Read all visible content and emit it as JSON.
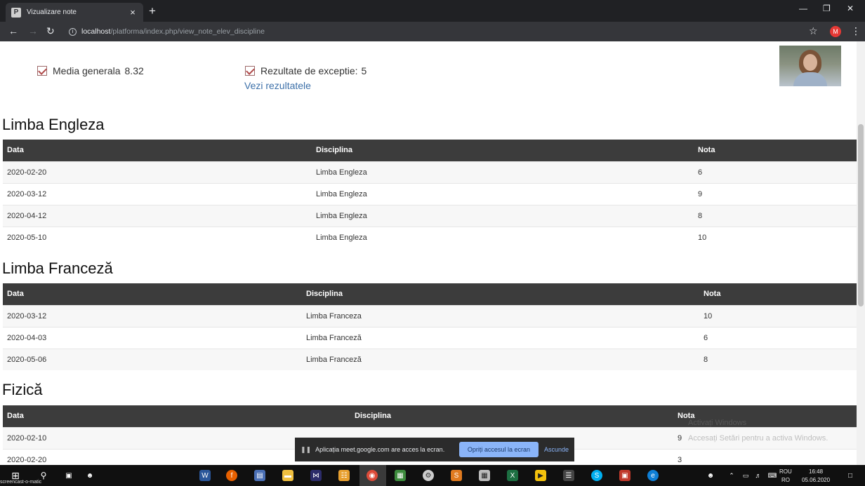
{
  "browser": {
    "tab_title": "Vizualizare note",
    "tab_close": "×",
    "new_tab": "+",
    "url_host": "localhost",
    "url_path": "/platforma/index.php/view_note_elev_discipline",
    "profile_initial": "M"
  },
  "stats": {
    "media_label": "Media generala",
    "media_value": "8.32",
    "rezultate_label": "Rezultate de exceptie:",
    "rezultate_value": "5",
    "vezi_link": "Vezi rezultatele"
  },
  "sections": [
    {
      "title": "Limba Engleza",
      "headers": [
        "Data",
        "Disciplina",
        "Nota"
      ],
      "rows": [
        [
          "2020-02-20",
          "Limba Engleza",
          "6"
        ],
        [
          "2020-03-12",
          "Limba Engleza",
          "9"
        ],
        [
          "2020-04-12",
          "Limba Engleza",
          "8"
        ],
        [
          "2020-05-10",
          "Limba Engleza",
          "10"
        ]
      ]
    },
    {
      "title": "Limba Franceză",
      "headers": [
        "Data",
        "Disciplina",
        "Nota"
      ],
      "rows": [
        [
          "2020-03-12",
          "Limba Franceza",
          "10"
        ],
        [
          "2020-04-03",
          "Limba Franceză",
          "6"
        ],
        [
          "2020-05-06",
          "Limba Franceză",
          "8"
        ]
      ]
    },
    {
      "title": "Fizică",
      "headers": [
        "Data",
        "Disciplina",
        "Nota"
      ],
      "rows": [
        [
          "2020-02-10",
          "",
          "9"
        ],
        [
          "2020-02-20",
          "",
          "3"
        ]
      ]
    }
  ],
  "share_bar": {
    "message": "Aplicația meet.google.com are acces la ecran.",
    "stop_label": "Opriți accesul la ecran",
    "hide_label": "Ascunde"
  },
  "watermark": {
    "line1": "Activați Windows",
    "line2": "Accesați Setări pentru a activa Windows."
  },
  "taskbar": {
    "lang_top": "ROU",
    "lang_bottom": "RO",
    "time": "16:48",
    "date": "05.06.2020",
    "recorder_label": "screencast-o-matic"
  },
  "colors": {
    "table_header": "#3c3c3c",
    "link": "#3b6fa8",
    "share_button": "#8ab4f8"
  }
}
